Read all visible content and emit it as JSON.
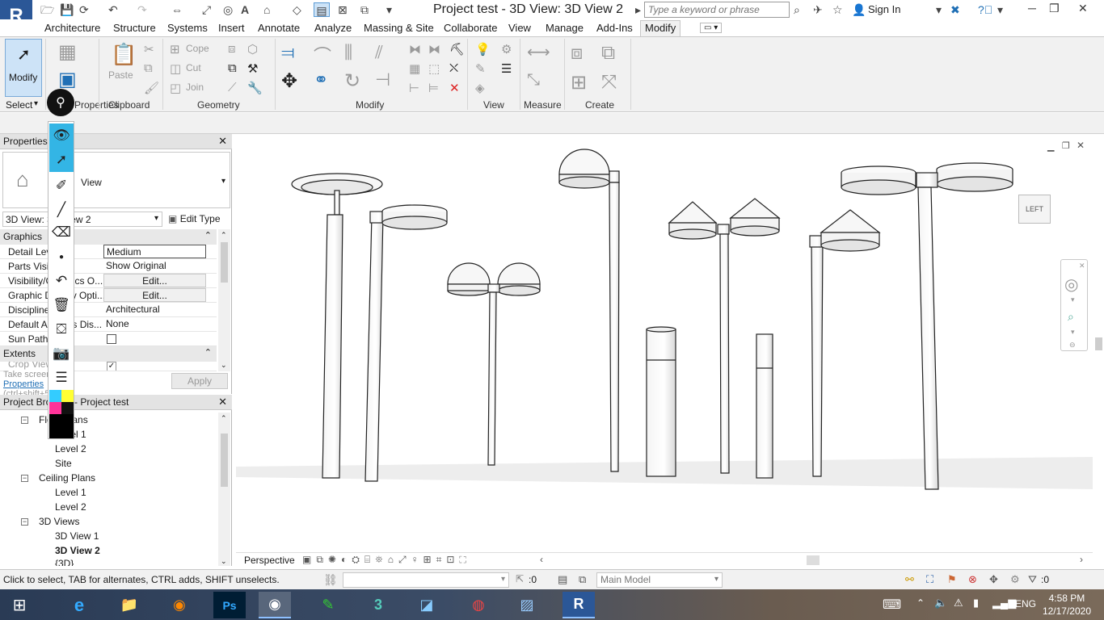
{
  "app": {
    "logo_letter": "R",
    "window_title": "Project test - 3D View: 3D View 2",
    "search_placeholder": "Type a keyword or phrase",
    "sign_in": "Sign In"
  },
  "ribbon_tabs": [
    "Architecture",
    "Structure",
    "Systems",
    "Insert",
    "Annotate",
    "Analyze",
    "Massing & Site",
    "Collaborate",
    "View",
    "Manage",
    "Add-Ins",
    "Modify"
  ],
  "ribbon": {
    "modify_label": "Modify",
    "select_label": "Select",
    "properties_label": "Properties",
    "paste_label": "Paste",
    "cope_label": "Cope",
    "cut_label": "Cut",
    "join_label": "Join",
    "panels": [
      "Clipboard",
      "Geometry",
      "Modify",
      "View",
      "Measure",
      "Create"
    ]
  },
  "properties": {
    "header": "Properties",
    "type_name": "View",
    "view_selector": "3D View: 3D View 2",
    "edit_type": "Edit Type",
    "groups": [
      "Graphics",
      "Extents"
    ],
    "rows": [
      {
        "name": "Detail Level",
        "value": "Medium"
      },
      {
        "name": "Parts Visibility",
        "value": "Show Original"
      },
      {
        "name": "Visibility/Graphics O...",
        "value": "Edit..."
      },
      {
        "name": "Graphic Display Opti...",
        "value": "Edit..."
      },
      {
        "name": "Discipline",
        "value": "Architectural"
      },
      {
        "name": "Default Analysis Dis...",
        "value": "None"
      },
      {
        "name": "Sun Path",
        "value": ""
      }
    ],
    "crop_view": "Crop View",
    "apply": "Apply",
    "tooltip_title": "Take screenshot",
    "tooltip_link": "Properties",
    "tooltip_shortcut": "(ctrl+shift+5)"
  },
  "browser": {
    "header": "Project Browser - Project test",
    "items": [
      {
        "label": "Floor Plans",
        "level": 1,
        "toggle": "−"
      },
      {
        "label": "Level 1",
        "level": 2
      },
      {
        "label": "Level 2",
        "level": 2
      },
      {
        "label": "Site",
        "level": 2
      },
      {
        "label": "Ceiling Plans",
        "level": 1,
        "toggle": "−"
      },
      {
        "label": "Level 1",
        "level": 2
      },
      {
        "label": "Level 2",
        "level": 2
      },
      {
        "label": "3D Views",
        "level": 1,
        "toggle": "−"
      },
      {
        "label": "3D View 1",
        "level": 2
      },
      {
        "label": "3D View 2",
        "level": 2,
        "bold": true
      },
      {
        "label": "{3D}",
        "level": 2
      }
    ]
  },
  "viewport": {
    "view_cube_label": "LEFT",
    "perspective_label": "Perspective"
  },
  "status": {
    "text": "Click to select, TAB for alternates, CTRL adds, SHIFT unselects.",
    "workset_count": ":0",
    "model": "Main Model",
    "filter_count": ":0"
  },
  "taskbar": {
    "time": "4:58 PM",
    "date": "12/17/2020",
    "lang": "ENG"
  },
  "colors": {
    "accent_blue": "#33b5e5",
    "revit_blue": "#2b5797",
    "ribbon_bg": "#f1f1f1"
  }
}
